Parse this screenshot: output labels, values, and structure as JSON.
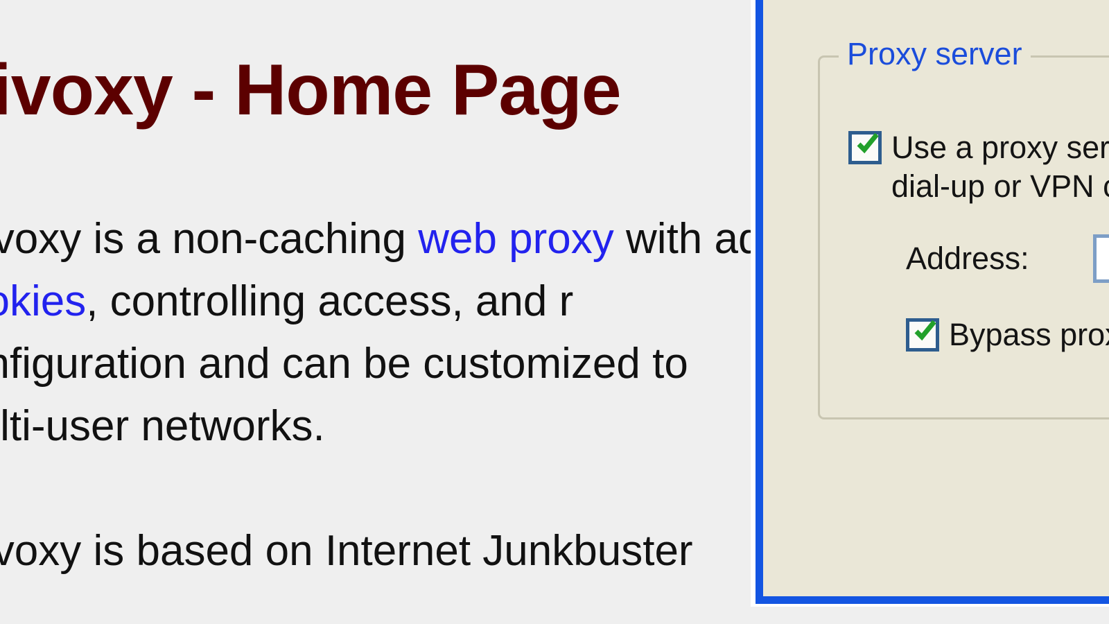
{
  "webpage": {
    "heading": "Privoxy - Home Page",
    "heading_color": "#5c0000",
    "link_color": "#2222ee",
    "background_color": "#efefef",
    "paragraph_1": {
      "line_1_pre": "Privoxy is a non-caching ",
      "line_1_link": "web proxy",
      "line_1_post": " with ad",
      "line_2_link": "cookies",
      "line_2_post": ", controlling access, and r",
      "line_3": "configuration and can be customized to",
      "line_4": "multi-user networks."
    },
    "paragraph_2": {
      "line_1": "Privoxy is based on Internet Junkbuster"
    }
  },
  "dialog": {
    "border_color": "#1355e2",
    "background_color": "#eae7d7",
    "groupbox": {
      "title": "Proxy server",
      "title_color": "#1b4ddb",
      "border_color": "#c8c5b1"
    },
    "use_proxy_checkbox": {
      "checked": true,
      "label_line_1": "Use a proxy server for your LAN (These settings will not apply to",
      "label_line_2": "dial-up or VPN connections)."
    },
    "address_field": {
      "label": "Address:",
      "value": "",
      "placeholder": ""
    },
    "bypass_checkbox": {
      "checked": true,
      "label": "Bypass proxy server for local addresses"
    },
    "checkbox_border_color": "#2e5d8e",
    "check_color": "#22a02a",
    "input_border_color": "#7d9ec6"
  }
}
